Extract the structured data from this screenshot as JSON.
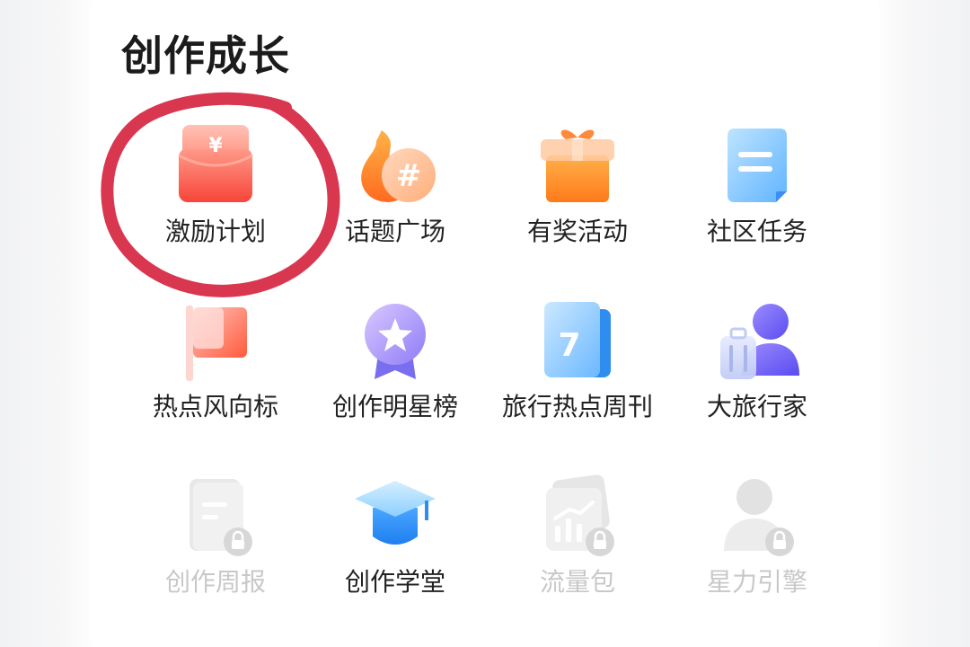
{
  "section": {
    "title": "创作成长"
  },
  "items": [
    {
      "label": "激励计划",
      "icon": "red-envelope-yen-icon"
    },
    {
      "label": "话题广场",
      "icon": "fire-hashtag-icon"
    },
    {
      "label": "有奖活动",
      "icon": "gift-box-icon"
    },
    {
      "label": "社区任务",
      "icon": "task-document-icon"
    },
    {
      "label": "热点风向标",
      "icon": "flag-icon"
    },
    {
      "label": "创作明星榜",
      "icon": "star-medal-icon"
    },
    {
      "label": "旅行热点周刊",
      "icon": "calendar-7-icon"
    },
    {
      "label": "大旅行家",
      "icon": "traveler-luggage-icon"
    },
    {
      "label": "创作周报",
      "icon": "report-lock-icon",
      "locked": true
    },
    {
      "label": "创作学堂",
      "icon": "graduation-cap-icon"
    },
    {
      "label": "流量包",
      "icon": "traffic-chart-lock-icon",
      "locked": true
    },
    {
      "label": "星力引擎",
      "icon": "user-lock-icon",
      "locked": true
    }
  ],
  "colors": {
    "annotation_circle": "#d9364f",
    "disabled_label": "#c8c8c8",
    "label": "#222222"
  }
}
